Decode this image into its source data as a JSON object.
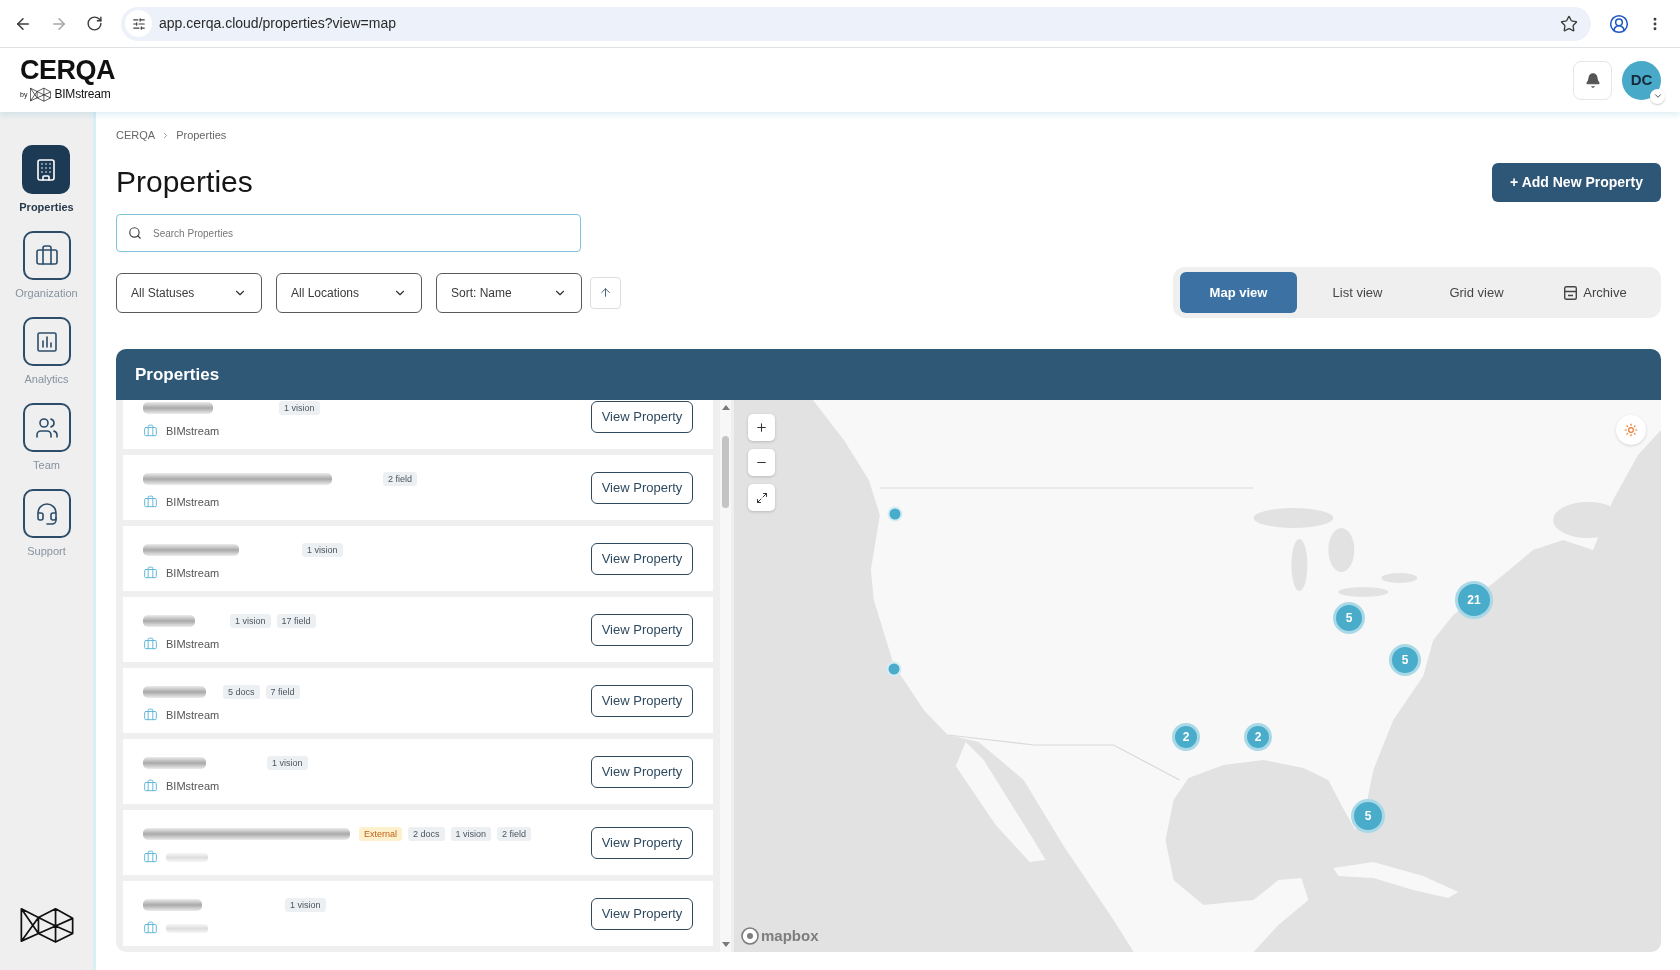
{
  "browser": {
    "url": "app.cerqa.cloud/properties?view=map"
  },
  "header": {
    "logo": {
      "title": "CERQA",
      "byline": "by",
      "brand": "BIMstream"
    },
    "avatar": {
      "initials": "DC"
    }
  },
  "sidebar": {
    "items": [
      {
        "label": "Properties",
        "selected": true
      },
      {
        "label": "Organization",
        "selected": false
      },
      {
        "label": "Analytics",
        "selected": false
      },
      {
        "label": "Team",
        "selected": false
      },
      {
        "label": "Support",
        "selected": false
      }
    ]
  },
  "breadcrumb": [
    {
      "label": "CERQA"
    },
    {
      "label": "Properties"
    }
  ],
  "page": {
    "title": "Properties",
    "add_button": "+ Add New Property",
    "search": {
      "placeholder": "Search Properties"
    },
    "filters": [
      {
        "value": "All Statuses"
      },
      {
        "value": "All Locations"
      },
      {
        "value": "Sort: Name"
      }
    ],
    "view_tabs": [
      {
        "label": "Map view",
        "selected": true,
        "kind": "view"
      },
      {
        "label": "List view",
        "selected": false,
        "kind": "view"
      },
      {
        "label": "Grid view",
        "selected": false,
        "kind": "view"
      },
      {
        "label": "Archive",
        "selected": false,
        "kind": "archive"
      }
    ]
  },
  "panel": {
    "title": "Properties",
    "properties": [
      {
        "badges": [
          {
            "label": "1 vision",
            "kind": "count"
          }
        ],
        "organization": "BIMstream",
        "button": "View Property"
      },
      {
        "badges": [
          {
            "label": "2 field",
            "kind": "count"
          }
        ],
        "organization": "BIMstream",
        "button": "View Property"
      },
      {
        "badges": [
          {
            "label": "1 vision",
            "kind": "count"
          }
        ],
        "organization": "BIMstream",
        "button": "View Property"
      },
      {
        "badges": [
          {
            "label": "1 vision",
            "kind": "count"
          },
          {
            "label": "17 field",
            "kind": "count"
          }
        ],
        "organization": "BIMstream",
        "button": "View Property"
      },
      {
        "badges": [
          {
            "label": "5 docs",
            "kind": "count"
          },
          {
            "label": "7 field",
            "kind": "count"
          }
        ],
        "organization": "BIMstream",
        "button": "View Property"
      },
      {
        "badges": [
          {
            "label": "1 vision",
            "kind": "count"
          }
        ],
        "organization": "BIMstream",
        "button": "View Property"
      },
      {
        "badges": [
          {
            "label": "External",
            "kind": "external"
          },
          {
            "label": "2 docs",
            "kind": "count"
          },
          {
            "label": "1 vision",
            "kind": "count"
          },
          {
            "label": "2 field",
            "kind": "count"
          }
        ],
        "button": "View Property"
      },
      {
        "badges": [
          {
            "label": "1 vision",
            "kind": "count"
          }
        ],
        "button": "View Property"
      }
    ],
    "map": {
      "markers": [
        {
          "kind": "point"
        },
        {
          "kind": "cluster",
          "count": "21"
        },
        {
          "kind": "cluster",
          "count": "5"
        },
        {
          "kind": "cluster",
          "count": "5"
        },
        {
          "kind": "point"
        },
        {
          "kind": "cluster",
          "count": "2"
        },
        {
          "kind": "cluster",
          "count": "2"
        },
        {
          "kind": "cluster",
          "count": "5"
        }
      ],
      "attribution": "mapbox"
    }
  }
}
